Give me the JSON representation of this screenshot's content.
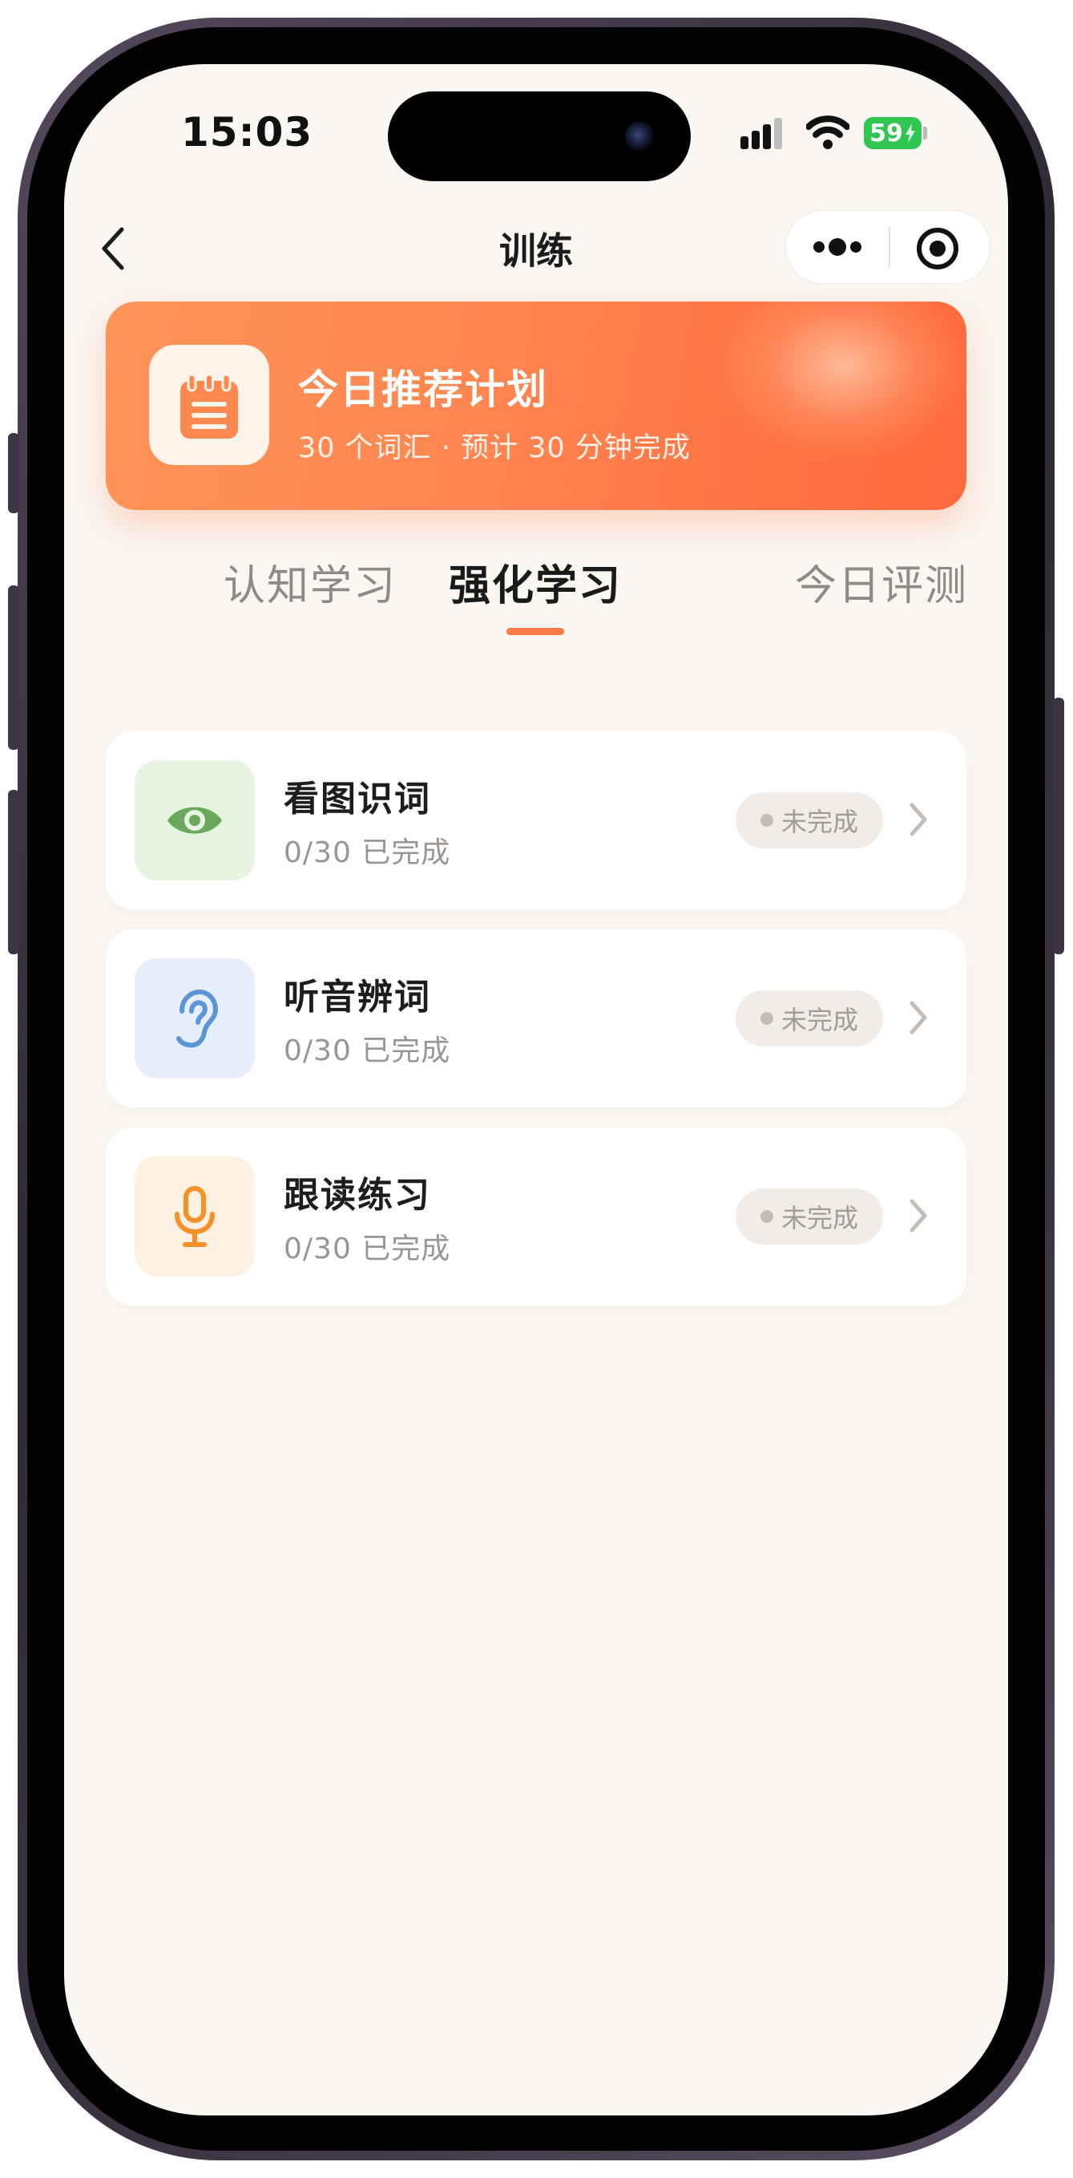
{
  "status_bar": {
    "time": "15:03",
    "battery": "59"
  },
  "nav": {
    "title": "训练",
    "back_icon": "chevron-left-icon",
    "more_icon": "more-dots-icon",
    "close_icon": "target-circle-icon"
  },
  "banner": {
    "title": "今日推荐计划",
    "subtitle": "30 个词汇 · 预计 30 分钟完成",
    "icon": "notepad-icon",
    "colors": {
      "start": "#ff9458",
      "end": "#ff6a3d"
    }
  },
  "tabs": [
    {
      "label": "认知学习",
      "active": false
    },
    {
      "label": "强化学习",
      "active": true
    },
    {
      "label": "今日评测",
      "active": false
    }
  ],
  "accent_color": "#ff7a44",
  "tasks": [
    {
      "title": "看图识词",
      "progress": "0/30 已完成",
      "status": "未完成",
      "icon": "eye-icon",
      "icon_bg": "#e6f4e1",
      "icon_color": "#6aa85c"
    },
    {
      "title": "听音辨词",
      "progress": "0/30 已完成",
      "status": "未完成",
      "icon": "ear-icon",
      "icon_bg": "#e6eefc",
      "icon_color": "#5b95d6"
    },
    {
      "title": "跟读练习",
      "progress": "0/30 已完成",
      "status": "未完成",
      "icon": "microphone-icon",
      "icon_bg": "#fff1e1",
      "icon_color": "#f59127"
    }
  ]
}
